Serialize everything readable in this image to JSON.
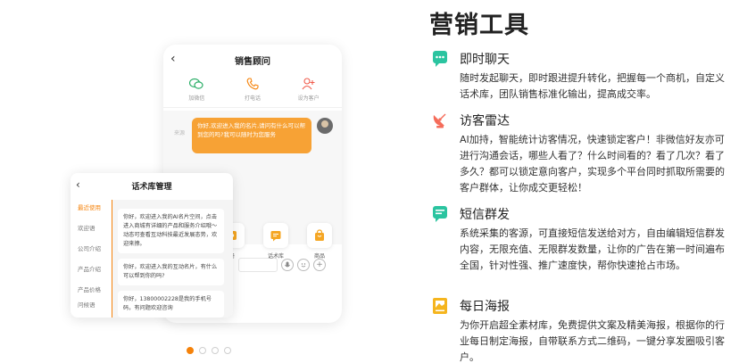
{
  "left_mock": {
    "chat": {
      "title": "销售顾问",
      "actions": [
        {
          "label": "加微信",
          "icon": "wechat-icon"
        },
        {
          "label": "打电话",
          "icon": "phone-icon"
        },
        {
          "label": "设为客户",
          "icon": "add-customer-icon"
        }
      ],
      "tag": "来源",
      "message": "你好,欢迎进入我的名片,请问有什么可以帮到您的吗?我可以随时为您服务",
      "tools": [
        {
          "label": "册",
          "icon": "album-icon"
        },
        {
          "label": "话术库",
          "icon": "script-library-icon"
        },
        {
          "label": "商品",
          "icon": "shopping-bag-icon"
        }
      ]
    },
    "library": {
      "title": "话术库管理",
      "categories": [
        "最近使用",
        "欢迎语",
        "公司介绍",
        "产品介绍",
        "产品价格",
        "问候语"
      ],
      "items": [
        "你好，欢迎进入我的AI名片空间，点击进入商城有详细的产品和服务介绍哦～动态可查看互动科技最近发展态势，欢迎来撩。",
        "你好，欢迎进入我的互动名片，有什么可以帮到你的吗?",
        "你好，13800002228是我的手机号码，有问题欢迎咨询"
      ]
    },
    "pager": {
      "count": 4,
      "active_index": 0
    }
  },
  "right_panel": {
    "title": "营销工具",
    "accent_color": "#f5820a",
    "features": [
      {
        "icon": "chat-icon",
        "name": "即时聊天",
        "desc": "随时发起聊天，即时跟进提升转化，把握每一个商机，自定义话术库，团队销售标准化输出，提高成交率。"
      },
      {
        "icon": "radar-icon",
        "name": "访客雷达",
        "desc": "AI加持，智能统计访客情况，快速锁定客户！非微信好友亦可进行沟通会话，哪些人看了？什么时间看的？看了几次？看了多久？都可以锁定意向客户，实现多个平台同时抓取所需要的客户群体，让你成交更轻松！"
      },
      {
        "icon": "sms-icon",
        "name": "短信群发",
        "desc": "系统采集的客源，可直接短信发送给对方，自由编辑短信群发内容，无限充值、无限群发数量，让你的广告在第一时间遍布全国，针对性强、推广速度快，帮你快速抢占市场。"
      },
      {
        "icon": "poster-icon",
        "name": "每日海报",
        "desc": "为你开启超全素材库，免费提供文案及精美海报，根据你的行业每日制定海报，自带联系方式二维码，一键分享发圈吸引客户。"
      }
    ]
  }
}
